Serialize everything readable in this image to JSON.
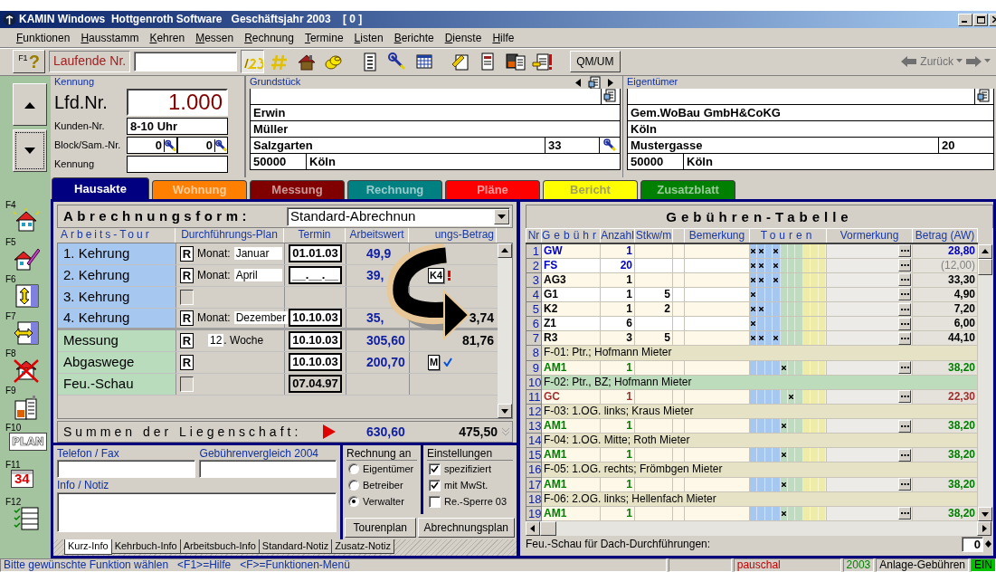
{
  "window": {
    "title": "KAMIN Windows  Hottgenroth Software   Geschäftsjahr 2003    [ 0 ]"
  },
  "menu": [
    "Funktionen",
    "Hausstamm",
    "Kehren",
    "Messen",
    "Rechnung",
    "Termine",
    "Listen",
    "Berichte",
    "Dienste",
    "Hilfe"
  ],
  "toolbar": {
    "help_key": "F1",
    "help_mark": "?",
    "number_label": "Laufende Nr.",
    "first_icon_pressed": true,
    "qm_button": "QM/UM",
    "back_label": "Zurück",
    "nav_disabled": true
  },
  "record": {
    "section_label": "Kennung",
    "lfd_label": "Lfd.Nr.",
    "lfd_value": "1.000",
    "kunden_label": "Kunden-Nr.",
    "kunden_value": "8-10 Uhr",
    "block_label": "Block/Sam.-Nr.",
    "block_values": [
      "0",
      "0"
    ],
    "kennung_label": "Kennung"
  },
  "grundstueck": {
    "label": "Grundstück",
    "lines": [
      "Erwin",
      "Müller"
    ],
    "street": "Salzgarten",
    "number": "33",
    "zip": "50000",
    "city": "Köln"
  },
  "eigentuemer": {
    "label": "Eigentümer",
    "lines": [
      "Gem.WoBau GmbH&CoKG",
      "Köln"
    ],
    "street": "Mustergasse",
    "number": "20",
    "zip": "50000",
    "city": "Köln"
  },
  "tabs": [
    {
      "label": "Hausakte",
      "color": "#000080",
      "selected": true
    },
    {
      "label": "Wohnung",
      "color": "#ff8000",
      "selected": false
    },
    {
      "label": "Messung",
      "color": "#800000",
      "selected": false
    },
    {
      "label": "Rechnung",
      "color": "#008080",
      "selected": false
    },
    {
      "label": "Pläne",
      "color": "#ff0000",
      "selected": false
    },
    {
      "label": "Bericht",
      "color": "#ffff00",
      "selected": false
    },
    {
      "label": "Zusatzblatt",
      "color": "#008000",
      "selected": false
    }
  ],
  "function_keys": [
    {
      "key": "F4",
      "kind": "house"
    },
    {
      "key": "F5",
      "kind": "house_edit"
    },
    {
      "key": "F6",
      "kind": "resize_v"
    },
    {
      "key": "F7",
      "kind": "resize_h"
    },
    {
      "key": "F8",
      "kind": "house_cross"
    },
    {
      "key": "F9",
      "kind": "heater"
    },
    {
      "key": "F10",
      "kind": "plan",
      "text": "PLAN"
    },
    {
      "key": "F11",
      "kind": "calendar",
      "text": "34"
    },
    {
      "key": "F12",
      "kind": "checklist"
    }
  ],
  "abrechnung": {
    "label": "Abrechnungsform:",
    "value": "Standard-Abrechnun",
    "columns": [
      "Arbeits-Tour",
      "Durchführungs-Plan",
      "Termin",
      "Arbeitswert",
      "ungs-Betrag"
    ],
    "rows": [
      {
        "kind": "kehrung",
        "name": "1. Kehrung",
        "rhythm": "R",
        "plan_label": "Monat:",
        "plan_value": "Januar",
        "termin": "01.01.03",
        "termin_disabled": false,
        "arbeitswert": "49,9"
      },
      {
        "kind": "kehrung",
        "name": "2. Kehrung",
        "rhythm": "R",
        "plan_label": "Monat:",
        "plan_value": "April",
        "termin": "__.__.__",
        "termin_disabled": false,
        "arbeitswert": "39,",
        "badge": "K4",
        "alert": true,
        "done": false
      },
      {
        "kind": "kehrung",
        "name": "3. Kehrung",
        "alert": false,
        "done": false
      },
      {
        "kind": "kehrung",
        "name": "4. Kehrung",
        "rhythm": "R",
        "plan_label": "Monat:",
        "plan_value": "Dezember",
        "termin": "10.10.03",
        "termin_disabled": false,
        "arbeitswert": "35,",
        "betrag": "3,74"
      },
      {
        "kind": "other",
        "name": "Messung",
        "rhythm": "R",
        "week_value": "12",
        "week_label": ". Woche",
        "termin": "10.10.03",
        "termin_disabled": false,
        "arbeitswert": "305,60",
        "betrag": "81,76",
        "alert": false,
        "done": false
      },
      {
        "kind": "other",
        "name": "Abgaswege",
        "rhythm": "R",
        "termin": "10.10.03",
        "termin_disabled": false,
        "arbeitswert": "200,70",
        "badge": "M",
        "alert": false,
        "done": true
      },
      {
        "kind": "other",
        "name": "Feu.-Schau",
        "termin": "07.04.97",
        "termin_disabled": true,
        "alert": false,
        "done": false
      }
    ],
    "sum_label": "Summen der Liegenschaft:",
    "sum_arbeitswert": "630,60",
    "sum_betrag": "475,50"
  },
  "contact": {
    "phone_label": "Telefon / Fax",
    "compare_label": "Gebührenvergleich 2004",
    "info_label": "Info / Notiz"
  },
  "rechnung_an": {
    "label": "Rechnung an",
    "options": [
      {
        "label": "Eigentümer",
        "selected": false
      },
      {
        "label": "Betreiber",
        "selected": false
      },
      {
        "label": "Verwalter",
        "selected": true
      }
    ]
  },
  "einstellungen": {
    "label": "Einstellungen",
    "options": [
      {
        "label": "spezifiziert",
        "checked": true
      },
      {
        "label": "mit MwSt.",
        "checked": true
      },
      {
        "label": "Re.-Sperre 03",
        "checked": false
      }
    ]
  },
  "buttons": [
    "Tourenplan",
    "Abrechnungsplan"
  ],
  "note_tabs": [
    {
      "label": "Kurz-Info",
      "selected": true
    },
    {
      "label": "Kehrbuch-Info",
      "selected": false
    },
    {
      "label": "Arbeitsbuch-Info",
      "selected": false
    },
    {
      "label": "Standard-Notiz",
      "selected": false
    },
    {
      "label": "Zusatz-Notiz",
      "selected": false
    }
  ],
  "fee_table": {
    "title": "Gebühren-Tabelle",
    "columns": [
      "Nr",
      "Gebühr",
      "Anzahl",
      "Stkw/m",
      "Bemerkung",
      "Touren",
      "Vormerkung",
      "Betrag (AW)"
    ],
    "rows": [
      {
        "kind": "fee",
        "nr": "1",
        "code": "GW",
        "anzahl": "1",
        "color": "#0000c0",
        "excluded": false,
        "touren": [
          true,
          true,
          false,
          true,
          false,
          false,
          false,
          false,
          false,
          false
        ],
        "betrag": "28,80"
      },
      {
        "kind": "fee",
        "nr": "2",
        "code": "FS",
        "anzahl": "20",
        "color": "#0000c0",
        "excluded": true,
        "touren": [
          true,
          true,
          false,
          true,
          false,
          false,
          false,
          false,
          false,
          false
        ],
        "betrag": "(12,00)"
      },
      {
        "kind": "fee",
        "nr": "3",
        "code": "AG3",
        "anzahl": "1",
        "color": "#000000",
        "excluded": false,
        "touren": [
          true,
          true,
          false,
          true,
          false,
          false,
          false,
          false,
          false,
          false
        ],
        "betrag": "33,30"
      },
      {
        "kind": "fee",
        "nr": "4",
        "code": "G1",
        "anzahl": "1",
        "stkw": "5",
        "color": "#000000",
        "excluded": false,
        "touren": [
          true,
          false,
          false,
          false,
          false,
          false,
          false,
          false,
          false,
          false
        ],
        "betrag": "4,90"
      },
      {
        "kind": "fee",
        "nr": "5",
        "code": "K2",
        "anzahl": "1",
        "stkw": "2",
        "color": "#000000",
        "excluded": false,
        "touren": [
          true,
          true,
          false,
          false,
          false,
          false,
          false,
          false,
          false,
          false
        ],
        "betrag": "7,20"
      },
      {
        "kind": "fee",
        "nr": "6",
        "code": "Z1",
        "anzahl": "6",
        "color": "#000000",
        "excluded": false,
        "touren": [
          true,
          false,
          false,
          false,
          false,
          false,
          false,
          false,
          false,
          false
        ],
        "betrag": "6,00"
      },
      {
        "kind": "fee",
        "nr": "7",
        "code": "R3",
        "anzahl": "3",
        "stkw": "5",
        "color": "#000000",
        "excluded": false,
        "touren": [
          true,
          true,
          false,
          true,
          false,
          false,
          false,
          false,
          false,
          false
        ],
        "betrag": "44,10"
      },
      {
        "kind": "group",
        "nr": "8",
        "text": "F-01: Ptr.; Hofmann Mieter",
        "color": "#e6e2c6"
      },
      {
        "kind": "fee",
        "nr": "9",
        "code": "AM1",
        "anzahl": "1",
        "color": "#008000",
        "excluded": false,
        "touren": [
          false,
          false,
          false,
          false,
          true,
          false,
          false,
          false,
          false,
          false
        ],
        "betrag": "38,20"
      },
      {
        "kind": "group",
        "nr": "10",
        "text": "F-02: Ptr., BZ; Hofmann Mieter",
        "color": "#bcdcbc"
      },
      {
        "kind": "fee",
        "nr": "11",
        "code": "GC",
        "anzahl": "1",
        "color": "#a03030",
        "excluded": false,
        "touren": [
          false,
          false,
          false,
          false,
          false,
          true,
          false,
          false,
          false,
          false
        ],
        "betrag": "22,30"
      },
      {
        "kind": "group",
        "nr": "12",
        "text": "F-03: 1.OG. links; Kraus Mieter",
        "color": "#e6e2c6"
      },
      {
        "kind": "fee",
        "nr": "13",
        "code": "AM1",
        "anzahl": "1",
        "color": "#008000",
        "excluded": false,
        "touren": [
          false,
          false,
          false,
          false,
          true,
          false,
          false,
          false,
          false,
          false
        ],
        "betrag": "38,20"
      },
      {
        "kind": "group",
        "nr": "14",
        "text": "F-04: 1.OG. Mitte; Roth Mieter",
        "color": "#e6e2c6"
      },
      {
        "kind": "fee",
        "nr": "15",
        "code": "AM1",
        "anzahl": "1",
        "color": "#008000",
        "excluded": false,
        "touren": [
          false,
          false,
          false,
          false,
          true,
          false,
          false,
          false,
          false,
          false
        ],
        "betrag": "38,20"
      },
      {
        "kind": "group",
        "nr": "16",
        "text": "F-05: 1.OG. rechts; Frömbgen Mieter",
        "color": "#e6e2c6"
      },
      {
        "kind": "fee",
        "nr": "17",
        "code": "AM1",
        "anzahl": "1",
        "color": "#008000",
        "excluded": false,
        "touren": [
          false,
          false,
          false,
          false,
          true,
          false,
          false,
          false,
          false,
          false
        ],
        "betrag": "38,20"
      },
      {
        "kind": "group",
        "nr": "18",
        "text": "F-06: 2.OG. links; Hellenfach Mieter",
        "color": "#e6e2c6"
      },
      {
        "kind": "fee",
        "nr": "19",
        "code": "AM1",
        "anzahl": "1",
        "color": "#008000",
        "excluded": false,
        "touren": [
          false,
          false,
          false,
          false,
          true,
          false,
          false,
          false,
          false,
          false
        ],
        "betrag": "38,20"
      }
    ],
    "footer_label": "Feu.-Schau für Dach-Durchführungen:",
    "footer_value": "0"
  },
  "status_bar": {
    "message": "Bitte gewünschte Funktion wählen   <F1>=Hilfe   <F>=Funktionen-Menü",
    "panels": [
      {
        "text": "pauschal",
        "kind": "plain",
        "color": "#c00000"
      },
      {
        "text": "2003",
        "kind": "plain",
        "color": "#008000"
      },
      {
        "text": "Anlage-Gebühren",
        "kind": "plain",
        "color": "#000000"
      },
      {
        "text": "EIN",
        "kind": "highlight",
        "color": "#00c000"
      }
    ]
  }
}
